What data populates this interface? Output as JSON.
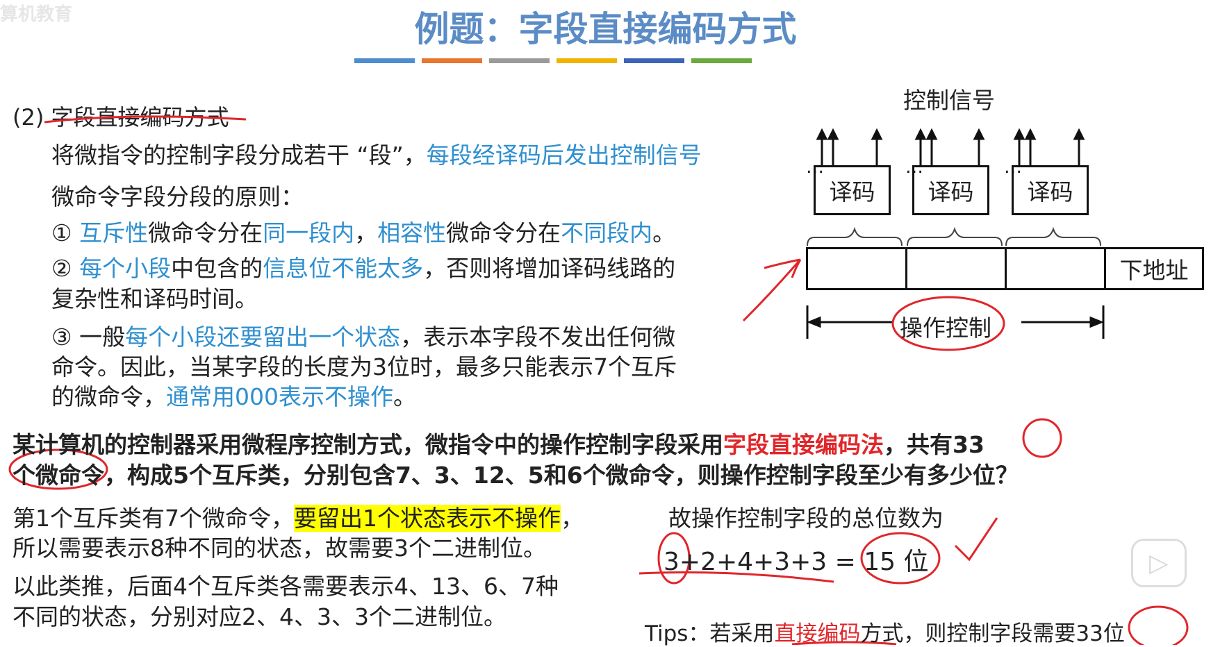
{
  "watermark": "算机教育",
  "title": "例题：字段直接编码方式",
  "title_bar_colors": [
    "#4f8cd0",
    "#e8762e",
    "#9a9a9a",
    "#f0b400",
    "#3d63b8",
    "#6aaa3c"
  ],
  "section": {
    "heading": "(2) 字段直接编码方式",
    "intro_a": "将微指令的控制字段分成若干 “段”，",
    "intro_b": "每段经译码后发出控制信号",
    "principle_title": "微命令字段分段的原则：",
    "rule1": {
      "n": "①",
      "a": "互斥性",
      "b": "微命令分在",
      "c": "同一段内",
      "d": "，",
      "e": "相容性",
      "f": "微命令分在",
      "g": "不同段内",
      "h": "。"
    },
    "rule2": {
      "n": "②",
      "a": "每个小段",
      "b": "中包含的",
      "c": "信息位不能太多",
      "d": "，否则将增加译码线路的",
      "e": "复杂性和译码时间。"
    },
    "rule3": {
      "n": "③ 一般",
      "a": "每个小段还要留出一个状态",
      "b": "，表示本字段不发出任何微",
      "c": "命令。因此，当某字段的长度为3位时，最多只能表示7个互斥",
      "d": "的微命令，",
      "e": "通常用000表示不操作",
      "f": "。"
    }
  },
  "diagram": {
    "signal_label": "控制信号",
    "dots": "…",
    "decoders": [
      "译码",
      "译码",
      "译码"
    ],
    "next_addr": "下地址",
    "op_control": "操作控制"
  },
  "question": {
    "a": "某计算机的控制器采用微程序控制方式，微指令中的操作控制字段采用",
    "b": "字段直接编码法",
    "c": "，共有33",
    "d": "个微命令，构成5个互斥类，分别包含7、3、12、5和6个微命令，则操作控制字段至少有多少位？"
  },
  "answer": {
    "p1_a": "第1个互斥类有7个微命令，",
    "p1_b": "要留出1个状态表示不操作",
    "p1_c": "，",
    "p1_d": "所以需要表示8种不同的状态，故需要3个二进制位。",
    "p2_a": "以此类推，后面4个互斥类各需要表示4、13、6、7种",
    "p2_b": "不同的状态，分别对应2、4、3、3个二进制位。",
    "total_label": "故操作控制字段的总位数为",
    "formula": "3+2+4+3+3 = 15 位",
    "tips_a": "Tips：若采用",
    "tips_b": "直接编码",
    "tips_c": "方式，则控制字段需要33位"
  },
  "icons": {
    "play": "play-icon"
  }
}
